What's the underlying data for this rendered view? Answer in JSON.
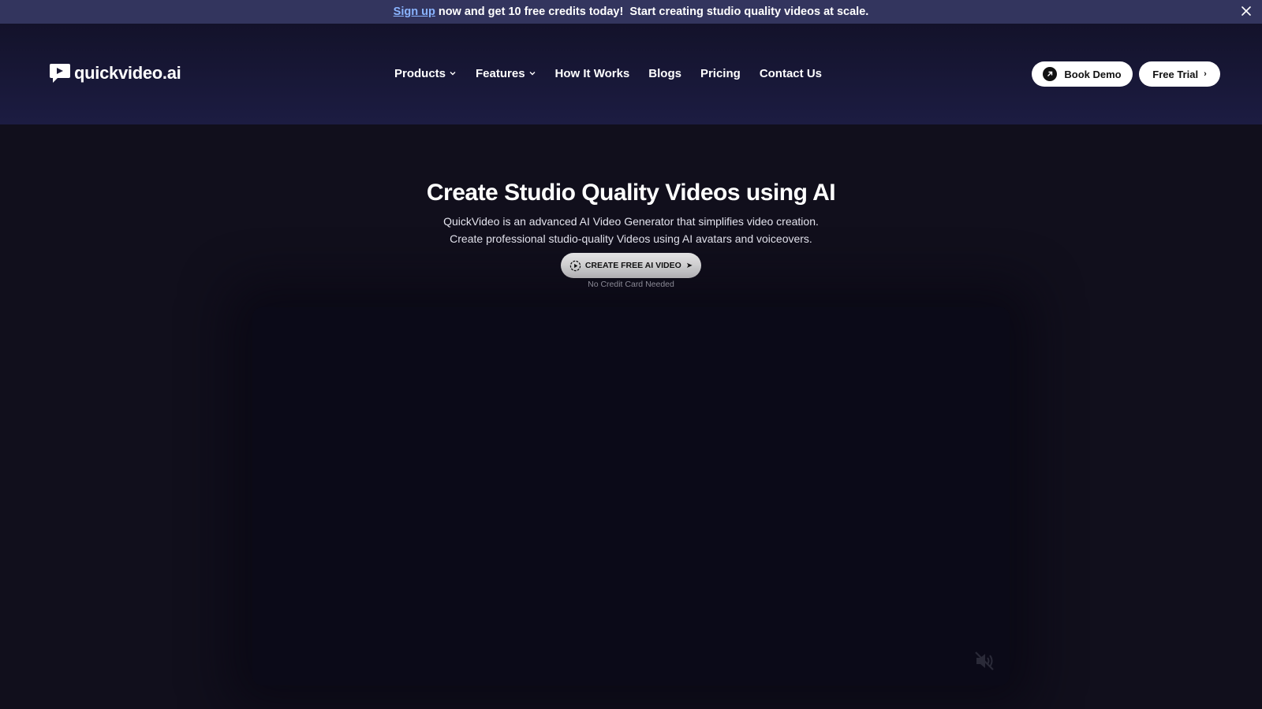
{
  "announcement": {
    "signup_link": "Sign up",
    "message": "now and get 10 free credits today!",
    "message2": "Start creating studio quality videos at scale.",
    "close_icon": "close-icon"
  },
  "header": {
    "logo_text": "quickvideo.ai",
    "nav": [
      {
        "label": "Products",
        "has_dropdown": true
      },
      {
        "label": "Features",
        "has_dropdown": true
      },
      {
        "label": "How It Works",
        "has_dropdown": false
      },
      {
        "label": "Blogs",
        "has_dropdown": false
      },
      {
        "label": "Pricing",
        "has_dropdown": false
      },
      {
        "label": "Contact Us",
        "has_dropdown": false
      }
    ],
    "book_demo": "Book Demo",
    "free_trial": "Free Trial"
  },
  "hero": {
    "title": "Create Studio Quality Videos using AI",
    "subtitle_line1": "QuickVideo is an advanced AI Video Generator that simplifies video creation.",
    "subtitle_line2": "Create professional studio-quality Videos using AI avatars and voiceovers.",
    "cta_label": "CREATE FREE AI VIDEO",
    "cta_note": "No Credit Card Needed"
  },
  "video": {
    "muted": true,
    "mute_icon": "speaker-muted-icon"
  },
  "colors": {
    "announcement_bg": "#33355e",
    "link": "#8ab4ff",
    "page_bg": "#110f1c",
    "button_bg": "#ffffff"
  }
}
